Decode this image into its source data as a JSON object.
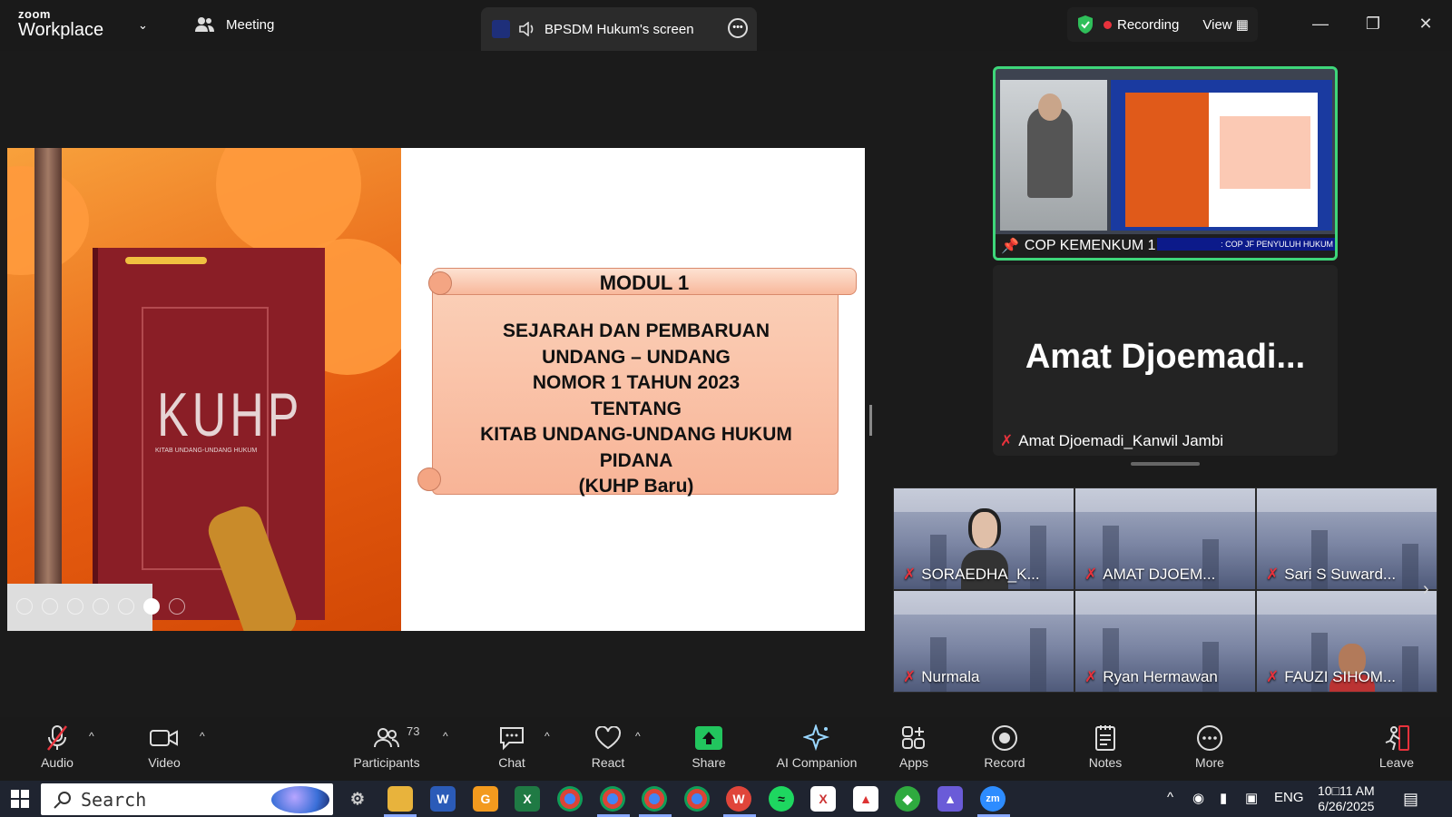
{
  "titlebar": {
    "logo_line1": "zoom",
    "logo_line2": "Workplace",
    "meeting_label": "Meeting",
    "share_label": "BPSDM Hukum's screen",
    "recording_label": "Recording",
    "view_label": "View"
  },
  "slide": {
    "kuhp": "KUHP",
    "kuhp_sub": "KITAB UNDANG-UNDANG HUKUM",
    "modul": "MODUL 1",
    "lines": [
      "SEJARAH DAN  PEMBARUAN",
      "UNDANG – UNDANG",
      "NOMOR 1 TAHUN 2023",
      "TENTANG",
      "KITAB UNDANG-UNDANG HUKUM",
      "PIDANA",
      "(KUHP Baru)"
    ]
  },
  "panel": {
    "cop_label": "COP KEMENKUM 1",
    "cop_marquee": ": COP JF PENYULUH HUKUM",
    "amat_big": "Amat  Djoemadi...",
    "amat_label": "Amat Djoemadi_Kanwil Jambi"
  },
  "gallery": [
    {
      "name": "SORAEDHA_K..."
    },
    {
      "name": "AMAT DJOEM..."
    },
    {
      "name": "Sari S Suward..."
    },
    {
      "name": "Nurmala"
    },
    {
      "name": "Ryan Hermawan"
    },
    {
      "name": "FAUZI SIHOM..."
    }
  ],
  "toolbar": {
    "audio": "Audio",
    "video": "Video",
    "participants": "Participants",
    "participants_count": "73",
    "chat": "Chat",
    "react": "React",
    "share": "Share",
    "ai": "AI Companion",
    "apps": "Apps",
    "record": "Record",
    "notes": "Notes",
    "more": "More",
    "leave": "Leave"
  },
  "taskbar": {
    "search": "Search",
    "lang": "ENG",
    "time": "10□11 AM",
    "date": "6/26/2025"
  },
  "colors": {
    "accent_green": "#3ed67a",
    "record_red": "#e8323c",
    "share_green": "#22c55e"
  }
}
